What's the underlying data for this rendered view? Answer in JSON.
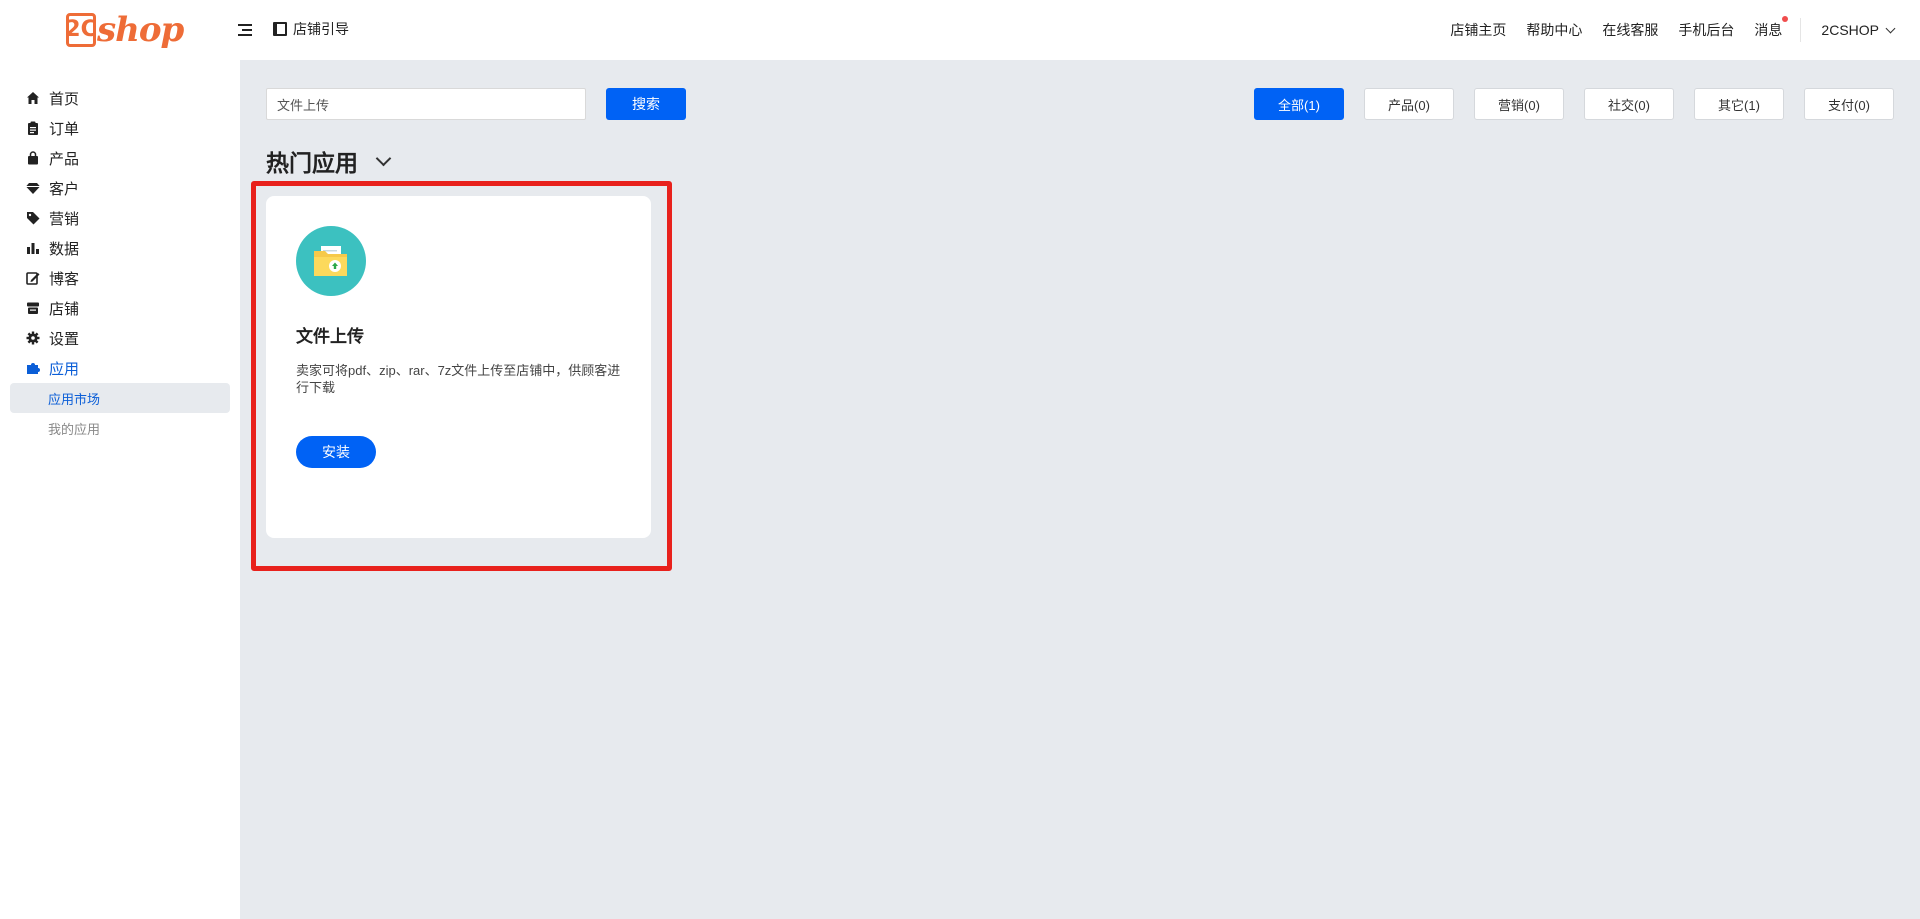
{
  "header": {
    "logo_prefix": "2C",
    "logo_text": "shop",
    "guide_label": "店铺引导",
    "nav": [
      "店铺主页",
      "帮助中心",
      "在线客服",
      "手机后台",
      "消息"
    ],
    "account": "2CSHOP"
  },
  "sidebar": {
    "items": [
      {
        "label": "首页",
        "icon": "home-icon"
      },
      {
        "label": "订单",
        "icon": "clipboard-icon"
      },
      {
        "label": "产品",
        "icon": "bag-icon"
      },
      {
        "label": "客户",
        "icon": "diamond-icon"
      },
      {
        "label": "营销",
        "icon": "tag-icon"
      },
      {
        "label": "数据",
        "icon": "bar-chart-icon"
      },
      {
        "label": "博客",
        "icon": "edit-icon"
      },
      {
        "label": "店铺",
        "icon": "store-icon"
      },
      {
        "label": "设置",
        "icon": "gear-icon"
      },
      {
        "label": "应用",
        "icon": "puzzle-icon"
      }
    ],
    "sub_items": [
      "应用市场",
      "我的应用"
    ]
  },
  "search": {
    "value": "文件上传",
    "button": "搜索"
  },
  "filters": [
    "全部(1)",
    "产品(0)",
    "营销(0)",
    "社交(0)",
    "其它(1)",
    "支付(0)"
  ],
  "section": {
    "title": "热门应用"
  },
  "apps": [
    {
      "name": "文件上传",
      "description": "卖家可将pdf、zip、rar、7z文件上传至店铺中，供顾客进行下载",
      "install_label": "安装",
      "icon": "folder-upload-icon"
    }
  ],
  "colors": {
    "brand": "#ee6c37",
    "primary": "#0062f5",
    "highlight": "#e8211c",
    "app_icon_bg": "#3cc1c0"
  }
}
